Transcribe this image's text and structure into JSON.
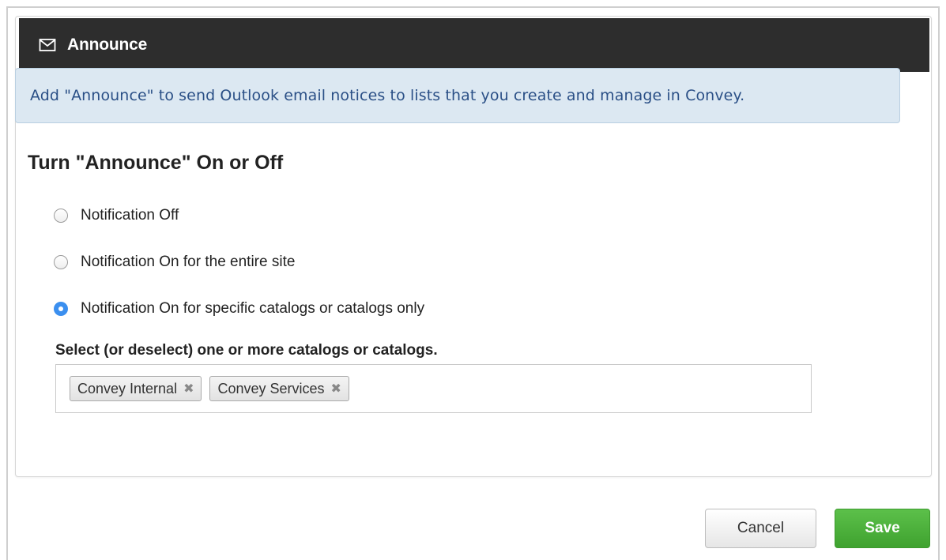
{
  "panel": {
    "title": "Announce",
    "icon": "envelope-icon"
  },
  "info": {
    "text": "Add \"Announce\" to send Outlook email notices to lists that you create and manage in Convey."
  },
  "section": {
    "title": "Turn \"Announce\" On or Off"
  },
  "radios": [
    {
      "label": "Notification Off",
      "checked": false
    },
    {
      "label": "Notification On for the entire site",
      "checked": false
    },
    {
      "label": "Notification On for specific catalogs or catalogs only",
      "checked": true
    }
  ],
  "catalogs": {
    "label": "Select (or deselect) one or more catalogs or catalogs.",
    "selected": [
      {
        "label": "Convey Internal",
        "remove": "✖"
      },
      {
        "label": "Convey Services",
        "remove": "✖"
      }
    ]
  },
  "buttons": {
    "cancel": "Cancel",
    "save": "Save"
  },
  "colors": {
    "header_bg": "#2d2d2d",
    "info_bg": "#dce8f2",
    "info_text": "#2a4f86",
    "radio_checked": "#3b8fef",
    "save_bg": "#4cb13b"
  }
}
